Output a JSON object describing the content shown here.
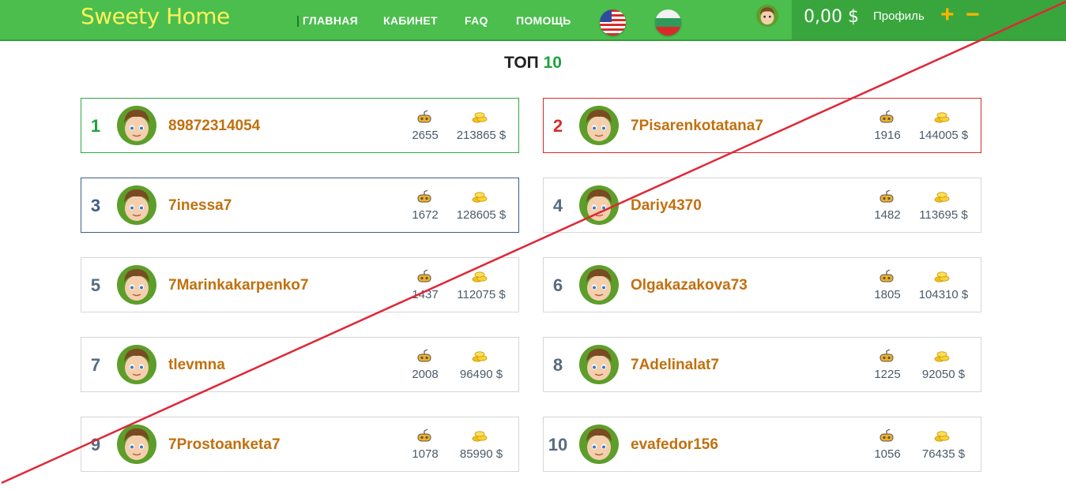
{
  "header": {
    "brand": "Sweety Home",
    "nav": [
      "ГЛАВНАЯ",
      "КАБИНЕТ",
      "FAQ",
      "ПОМОЩЬ"
    ],
    "balance": "0,00 $",
    "profile_label": "Профиль",
    "plus_label": "+",
    "minus_label": "−",
    "flags": [
      "us-flag-icon",
      "bg-flag-icon"
    ]
  },
  "top": {
    "title_prefix": "ТОП",
    "title_number": "10"
  },
  "colors": {
    "header_green": "#4bbe4e",
    "brand_yellow": "#fff25b",
    "username": "#c1700f",
    "rank1": "#1fa33b",
    "rank2": "#d62b2b",
    "rank3": "#3e5c8a",
    "rank_default": "#556b80",
    "overlay_line": "#e02636"
  },
  "leaders": [
    {
      "rank": "1",
      "name": "89872314054",
      "games": "2655",
      "coins": "213865 $"
    },
    {
      "rank": "2",
      "name": "7Pisarenkotatana7",
      "games": "1916",
      "coins": "144005 $"
    },
    {
      "rank": "3",
      "name": "7inessa7",
      "games": "1672",
      "coins": "128605 $"
    },
    {
      "rank": "4",
      "name": "Dariy4370",
      "games": "1482",
      "coins": "113695 $"
    },
    {
      "rank": "5",
      "name": "7Marinkakarpenko7",
      "games": "1437",
      "coins": "112075 $"
    },
    {
      "rank": "6",
      "name": "Olgakazakova73",
      "games": "1805",
      "coins": "104310 $"
    },
    {
      "rank": "7",
      "name": "tlevmna",
      "games": "2008",
      "coins": "96490 $"
    },
    {
      "rank": "8",
      "name": "7Adelinalat7",
      "games": "1225",
      "coins": "92050 $"
    },
    {
      "rank": "9",
      "name": "7Prostoanketa7",
      "games": "1078",
      "coins": "85990 $"
    },
    {
      "rank": "10",
      "name": "evafedor156",
      "games": "1056",
      "coins": "76435 $"
    }
  ]
}
